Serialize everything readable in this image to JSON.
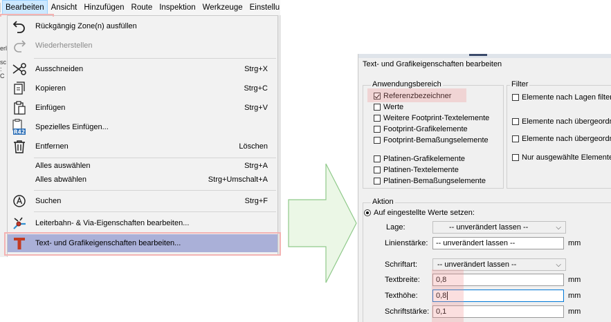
{
  "menubar": {
    "items": [
      "Bearbeiten",
      "Ansicht",
      "Hinzufügen",
      "Route",
      "Inspektion",
      "Werkzeuge",
      "Einstellu"
    ]
  },
  "edge_glyphs": [
    "erl",
    "sc",
    ": C"
  ],
  "menu": {
    "undo": {
      "label": "Rückgängig Zone(n) ausfüllen",
      "icon": "undo-icon"
    },
    "redo": {
      "label": "Wiederherstellen",
      "icon": "redo-icon"
    },
    "cut": {
      "label": "Ausschneiden",
      "shortcut": "Strg+X",
      "icon": "scissors-icon"
    },
    "copy": {
      "label": "Kopieren",
      "shortcut": "Strg+C",
      "icon": "copy-icon"
    },
    "paste": {
      "label": "Einfügen",
      "shortcut": "Strg+V",
      "icon": "paste-icon"
    },
    "paste_special": {
      "label": "Spezielles Einfügen...",
      "icon": "paste-special-icon",
      "badge": "R42"
    },
    "delete": {
      "label": "Entfernen",
      "shortcut": "Löschen",
      "icon": "trash-icon"
    },
    "select_all": {
      "label": "Alles auswählen",
      "shortcut": "Strg+A"
    },
    "deselect_all": {
      "label": "Alles abwählen",
      "shortcut": "Strg+Umschalt+A"
    },
    "find": {
      "label": "Suchen",
      "shortcut": "Strg+F",
      "icon": "search-icon"
    },
    "track_props": {
      "label": "Leiterbahn- & Via-Eigenschaften bearbeiten...",
      "icon": "track-via-icon"
    },
    "text_props": {
      "label": "Text- und Grafikeigenschaften bearbeiten...",
      "icon": "text-t-icon"
    }
  },
  "dialog": {
    "title": "Text- und Grafikeigenschaften bearbeiten",
    "scope": {
      "legend": "Anwendungsbereich",
      "items": [
        {
          "label": "Referenzbezeichner",
          "checked": true
        },
        {
          "label": "Werte",
          "checked": false
        },
        {
          "label": "Weitere Footprint-Textelemente",
          "checked": false
        },
        {
          "label": "Footprint-Grafikelemente",
          "checked": false
        },
        {
          "label": "Footprint-Bemaßungselemente",
          "checked": false
        },
        {
          "label": "Platinen-Grafikelemente",
          "checked": false
        },
        {
          "label": "Platinen-Textelemente",
          "checked": false
        },
        {
          "label": "Platinen-Bemaßungselemente",
          "checked": false
        }
      ]
    },
    "filter": {
      "legend": "Filter",
      "items": [
        {
          "label": "Elemente nach Lagen filtern:",
          "checked": false
        },
        {
          "label": "Elemente nach übergeordne",
          "checked": false
        },
        {
          "label": "Elemente nach übergeordne",
          "checked": false
        },
        {
          "label": "Nur ausgewählte Elemente",
          "checked": false
        }
      ]
    },
    "action": {
      "legend": "Aktion",
      "radio_label": "Auf eingestellte Werte setzen:",
      "layer": {
        "label": "Lage:",
        "value": "-- unverändert lassen --"
      },
      "line_width": {
        "label": "Linienstärke:",
        "value": "-- unverändert lassen --",
        "unit": "mm"
      },
      "font": {
        "label": "Schriftart:",
        "value": "-- unverändert lassen --"
      },
      "text_width": {
        "label": "Textbreite:",
        "value": "0,8",
        "unit": "mm"
      },
      "text_height": {
        "label": "Texthöhe:",
        "value": "0,8",
        "unit": "mm"
      },
      "thickness": {
        "label": "Schriftstärke:",
        "value": "0,1",
        "unit": "mm"
      }
    }
  },
  "colors": {
    "menu_highlight": "#aab0d8",
    "menubar_active": "#cce8ff",
    "annotation_red": "#f3b3b3",
    "arrow_fill": "#ebf7e6",
    "arrow_stroke": "#8fc98a",
    "focus_border": "#0078d7"
  }
}
